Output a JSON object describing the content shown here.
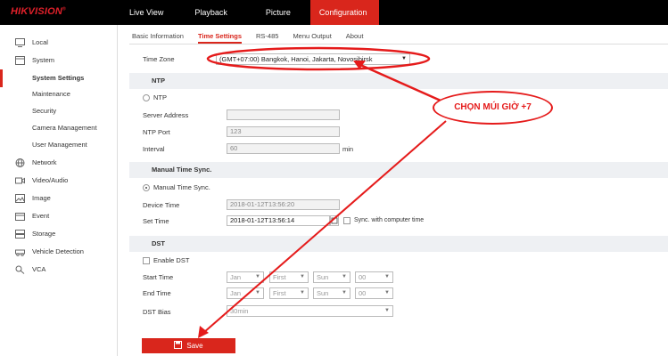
{
  "brand": {
    "logo": "HIKVISION"
  },
  "topnav": [
    "Live View",
    "Playback",
    "Picture",
    "Configuration"
  ],
  "sidebar": {
    "items": [
      {
        "label": "Local",
        "icon": "monitor-icon"
      },
      {
        "label": "System",
        "icon": "system-icon"
      },
      {
        "label": "System Settings"
      },
      {
        "label": "Maintenance"
      },
      {
        "label": "Security"
      },
      {
        "label": "Camera Management"
      },
      {
        "label": "User Management"
      },
      {
        "label": "Network",
        "icon": "globe-icon"
      },
      {
        "label": "Video/Audio",
        "icon": "video-icon"
      },
      {
        "label": "Image",
        "icon": "image-icon"
      },
      {
        "label": "Event",
        "icon": "calendar-icon"
      },
      {
        "label": "Storage",
        "icon": "storage-icon"
      },
      {
        "label": "Vehicle Detection",
        "icon": "vehicle-icon"
      },
      {
        "label": "VCA",
        "icon": "vca-icon"
      }
    ]
  },
  "tabs": [
    "Basic Information",
    "Time Settings",
    "RS-485",
    "Menu Output",
    "About"
  ],
  "time_zone": {
    "label": "Time Zone",
    "value": "(GMT+07:00) Bangkok, Hanoi, Jakarta, Novosibirsk"
  },
  "ntp": {
    "section": "NTP",
    "radio_label": "NTP",
    "server_label": "Server Address",
    "server_value": "",
    "port_label": "NTP Port",
    "port_value": "123",
    "interval_label": "Interval",
    "interval_value": "60",
    "interval_unit": "min"
  },
  "manual": {
    "section": "Manual Time Sync.",
    "radio_label": "Manual Time Sync.",
    "device_time_label": "Device Time",
    "device_time_value": "2018-01-12T13:56:20",
    "set_time_label": "Set Time",
    "set_time_value": "2018-01-12T13:56:14",
    "sync_label": "Sync. with computer time"
  },
  "dst": {
    "section": "DST",
    "enable_label": "Enable DST",
    "start_label": "Start Time",
    "end_label": "End Time",
    "bias_label": "DST Bias",
    "start": [
      "Jan",
      "First",
      "Sun",
      "00"
    ],
    "end": [
      "Jan",
      "First",
      "Sun",
      "00"
    ],
    "bias_value": "30min"
  },
  "save_label": "Save",
  "annotation_text": "CHỌN MÚI GIỜ +7",
  "colors": {
    "accent": "#d9261c",
    "annotation": "#e51b1b"
  }
}
